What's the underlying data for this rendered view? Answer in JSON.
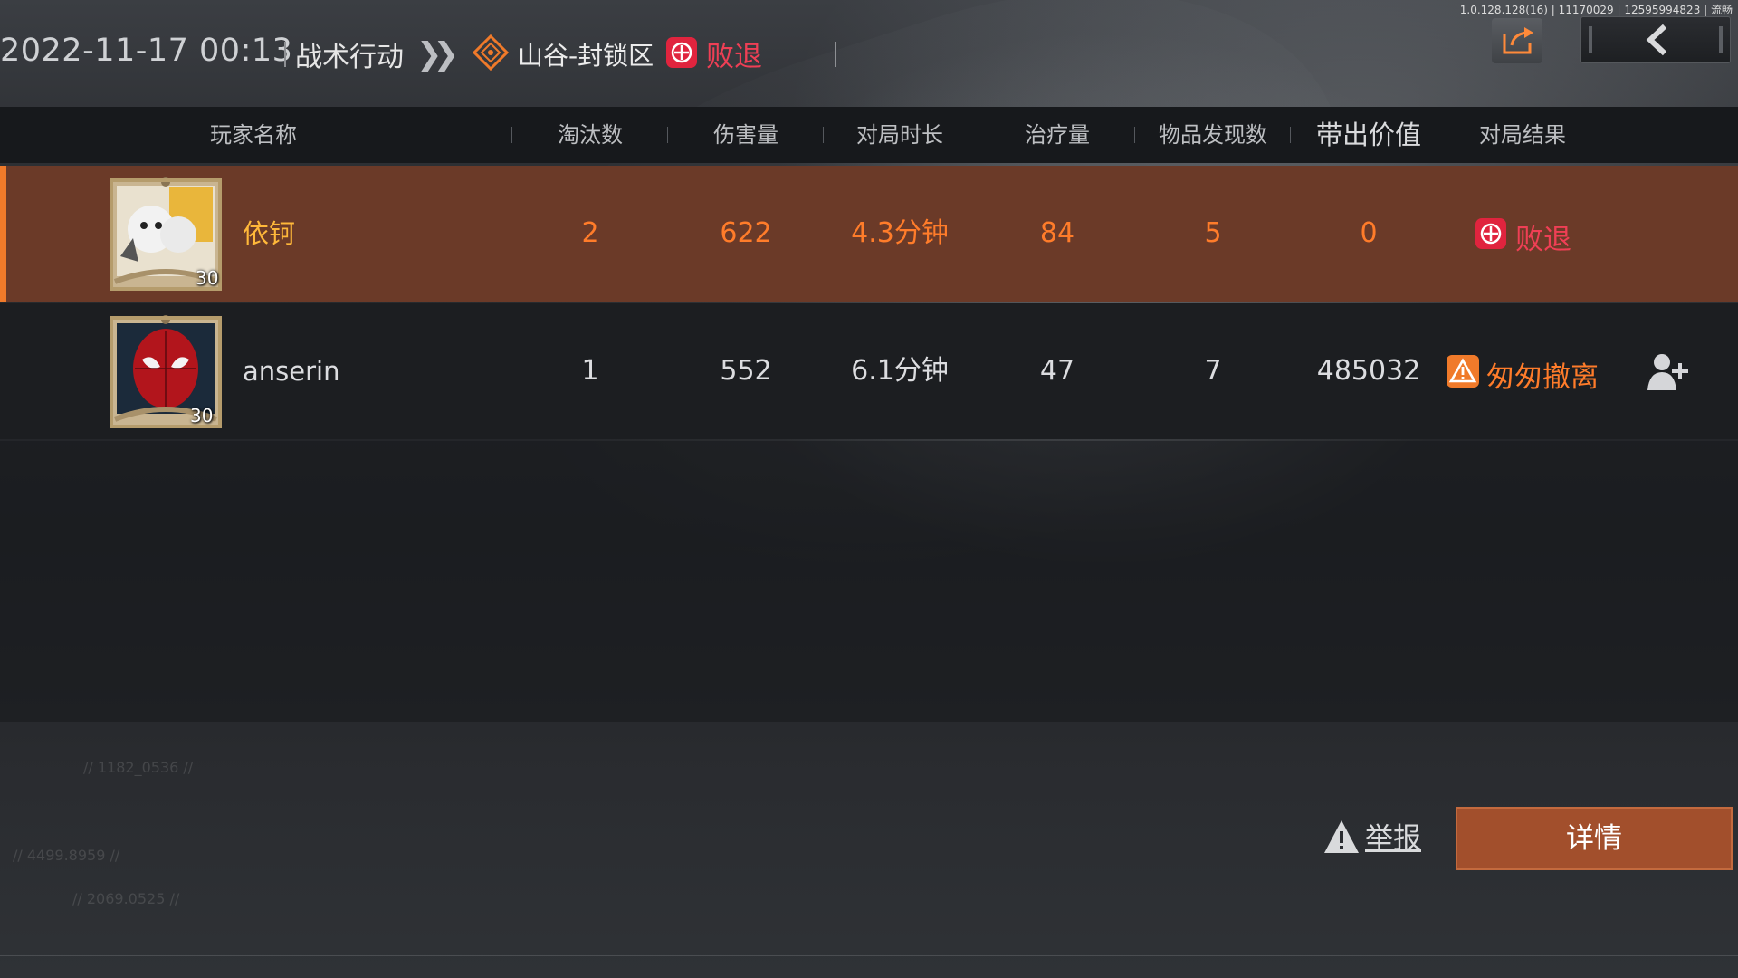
{
  "meta": {
    "build_info": "1.0.128.128(16) | 11170029 | 12595994823 | 流畅"
  },
  "header": {
    "datetime": "2022-11-17 00:13",
    "mode": "战术行动",
    "map": "山谷-封锁区",
    "result": "败退"
  },
  "columns": [
    "玩家名称",
    "淘汰数",
    "伤害量",
    "对局时长",
    "治疗量",
    "物品发现数",
    "带出价值",
    "对局结果"
  ],
  "players": [
    {
      "name": "依钶",
      "level": "30",
      "eliminations": "2",
      "damage": "622",
      "duration": "4.3分钟",
      "healing": "84",
      "items_found": "5",
      "extract_value": "0",
      "result": "败退",
      "is_self": true
    },
    {
      "name": "anserin",
      "level": "30",
      "eliminations": "1",
      "damage": "552",
      "duration": "6.1分钟",
      "healing": "47",
      "items_found": "7",
      "extract_value": "485032",
      "result": "匆匆撤离",
      "is_self": false
    }
  ],
  "footer": {
    "report_label": "举报",
    "detail_label": "详情",
    "hud_text_1": "// 1182_0536 //",
    "hud_text_2": "// 4499.8959 //",
    "hud_text_3": "// 2069.0525 //"
  },
  "colors": {
    "accent": "#f07a2a",
    "defeat": "#e0243e",
    "evac": "#f07a2a",
    "self_row": "#6b3a28",
    "detail_button": "#a24f2c"
  },
  "icons": {
    "share": "share-icon",
    "back": "back-arrow-icon",
    "map": "map-pin-icon",
    "defeat": "defeat-icon",
    "evac": "warning-icon",
    "add_friend": "add-friend-icon",
    "report": "warning-icon"
  }
}
